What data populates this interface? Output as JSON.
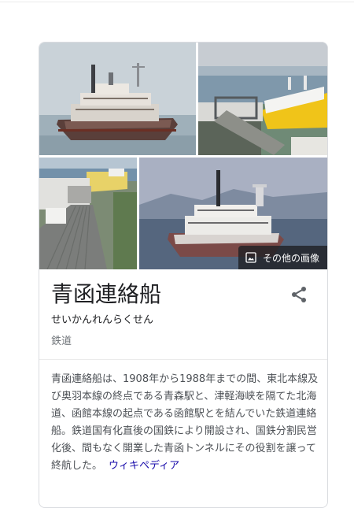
{
  "knowledge_panel": {
    "title": "青函連絡船",
    "reading": "せいかんれんらくせん",
    "category": "鉄道",
    "description": "青函連絡船は、1908年から1988年までの間、東北本線及び奥羽本線の終点である青森駅と、津軽海峡を隔てた北海道、函館本線の起点である函館駅とを結んでいた鉄道連絡船。鉄道国有化直後の国鉄により開設され、国鉄分割民営化後、間もなく開業した青函トンネルにその役割を譲って終航した。",
    "source_link": "ウィキペディア",
    "more_images_label": "その他の画像"
  },
  "icons": {
    "share": "share-icon",
    "more_images": "image-icon"
  },
  "colors": {
    "title": "#202124",
    "link": "#1a0dab",
    "muted": "#70757a",
    "body_text": "#4d5156",
    "hull_yellow": "#f0c419"
  }
}
